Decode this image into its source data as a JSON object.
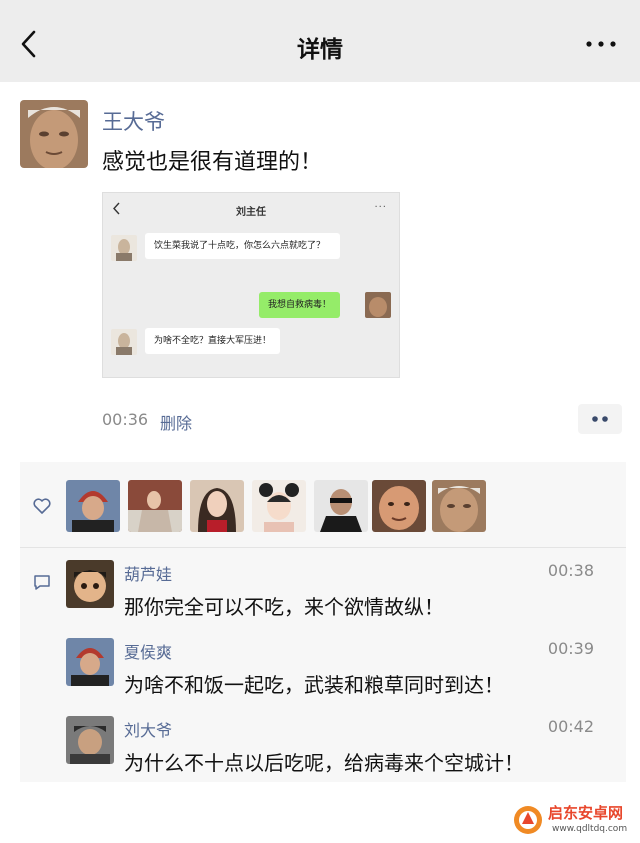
{
  "nav": {
    "title": "详情",
    "back_icon": "chevron-left-icon",
    "more_icon": "more-dots-icon"
  },
  "post": {
    "author": "王大爷",
    "text": "感觉也是很有道理的！",
    "time": "00:36",
    "delete_label": "删除",
    "screenshot": {
      "title": "刘主任",
      "messages": [
        {
          "side": "left",
          "text": "饮生菜我说了十点吃，你怎么六点就吃了？"
        },
        {
          "side": "right",
          "text": "我想自救病毒！"
        },
        {
          "side": "left",
          "text": "为啥不全吃？直接大军压进！"
        }
      ]
    }
  },
  "likes": {
    "icon": "heart-icon",
    "count_avatars": 7
  },
  "comments": {
    "icon": "comment-icon",
    "items": [
      {
        "name": "葫芦娃",
        "time": "00:38",
        "text": "那你完全可以不吃，来个欲情故纵！"
      },
      {
        "name": "夏侯爽",
        "time": "00:39",
        "text": "为啥不和饭一起吃，武装和粮草同时到达！"
      },
      {
        "name": "刘大爷",
        "time": "00:42",
        "text": "为什么不十点以后吃呢，给病毒来个空城计！"
      }
    ]
  },
  "watermark": {
    "name": "启东安卓网",
    "url": "www.qdltdq.com"
  },
  "colors": {
    "link": "#576b95",
    "nav_bg": "#ededed",
    "bubble_green": "#95ec69",
    "panel_bg": "#f7f7f7",
    "watermark_red": "#e8472c"
  }
}
